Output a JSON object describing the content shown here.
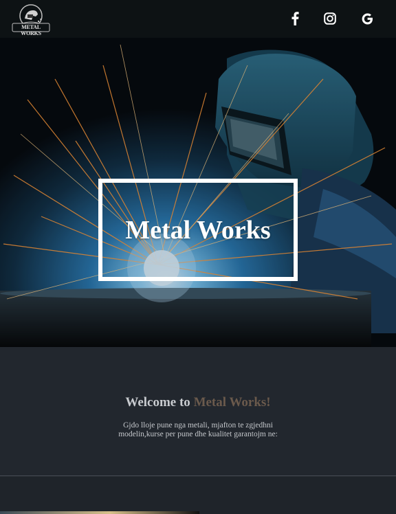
{
  "brand": {
    "logo_text": "METAL WORKS"
  },
  "nav": {
    "social": [
      {
        "name": "facebook",
        "icon": "facebook-icon"
      },
      {
        "name": "instagram",
        "icon": "instagram-icon"
      },
      {
        "name": "google",
        "icon": "google-icon"
      }
    ]
  },
  "hero": {
    "title": "Metal Works"
  },
  "welcome": {
    "heading_prefix": "Welcome to ",
    "heading_accent": "Metal Works!",
    "text": "Gjdo lloje pune nga metali, mjafton te zgjedhni modelin,kurse per pune dhe kualitet garantojm ne:"
  },
  "colors": {
    "navbar": "#0d1214",
    "section_bg": "#22272e",
    "accent": "#6b5a4c",
    "text": "#c9ccd0"
  }
}
